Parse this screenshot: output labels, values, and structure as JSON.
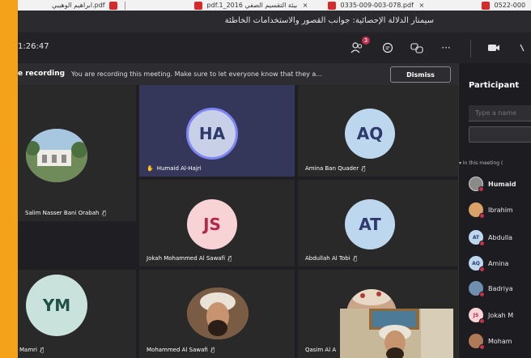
{
  "browser_tabs": [
    {
      "label": "ابراهيم الوهيبي.pdf",
      "close": "×"
    },
    {
      "label": "pdf.1_2016 بيئة التقسيم الصفي",
      "close": "×"
    },
    {
      "label": "0335-009-003-078.pdf",
      "close": "×"
    },
    {
      "label": "0522-000",
      "close": ""
    }
  ],
  "window_title": "سيمنار الدلالة الإحصائية: جوانب القصور والاستخدامات الخاطئة",
  "toolbar": {
    "timer": "1:26:47",
    "participants_badge": "3",
    "more": "···"
  },
  "recording_banner": {
    "title": "e recording",
    "message": "You are recording this meeting. Make sure to let everyone know that they a...",
    "dismiss_label": "Dismiss"
  },
  "tiles": [
    {
      "name": "Salim Nasser Bani Orabah",
      "kind": "photo"
    },
    {
      "name": "Humaid Al-Hajri",
      "initials": "HA",
      "raised_hand": "✋",
      "avatar_color": "#c7d0e6"
    },
    {
      "name": "Amina Ban Quader",
      "initials": "AQ",
      "avatar_color": "#bdd7ef"
    },
    {
      "name": "Jokah Mohammed Al Sawafi",
      "initials": "JS",
      "avatar_color": "#f7d3d6"
    },
    {
      "name": "Abdullah Al Tobi",
      "initials": "AT",
      "avatar_color": "#bdd7ef"
    },
    {
      "name": "Mamri",
      "initials": "YM",
      "avatar_color": "#c9e3dc"
    },
    {
      "name": "Mohammed Al Sawafi",
      "kind": "photo"
    },
    {
      "name": "Qasim Al A",
      "kind": "photo"
    }
  ],
  "participants_panel": {
    "title": "Participant",
    "search_placeholder": "Type a name",
    "section_label": "In this meeting (",
    "people": [
      {
        "name": "Humaid",
        "kind": "photo",
        "color": "#8a8a8a"
      },
      {
        "name": "Ibrahim",
        "kind": "photo",
        "color": "#d9a26a"
      },
      {
        "name": "Abdulla",
        "initials": "AT",
        "color": "#bdd7ef"
      },
      {
        "name": "Amina",
        "initials": "AQ",
        "color": "#bdd7ef"
      },
      {
        "name": "Badriya",
        "kind": "photo",
        "color": "#6f8fb0"
      },
      {
        "name": "Jokah M",
        "initials": "JS",
        "color": "#f7d3d6"
      },
      {
        "name": "Moham",
        "kind": "photo",
        "color": "#b07a58"
      }
    ]
  },
  "mic_muted_glyph": "🎙̸"
}
